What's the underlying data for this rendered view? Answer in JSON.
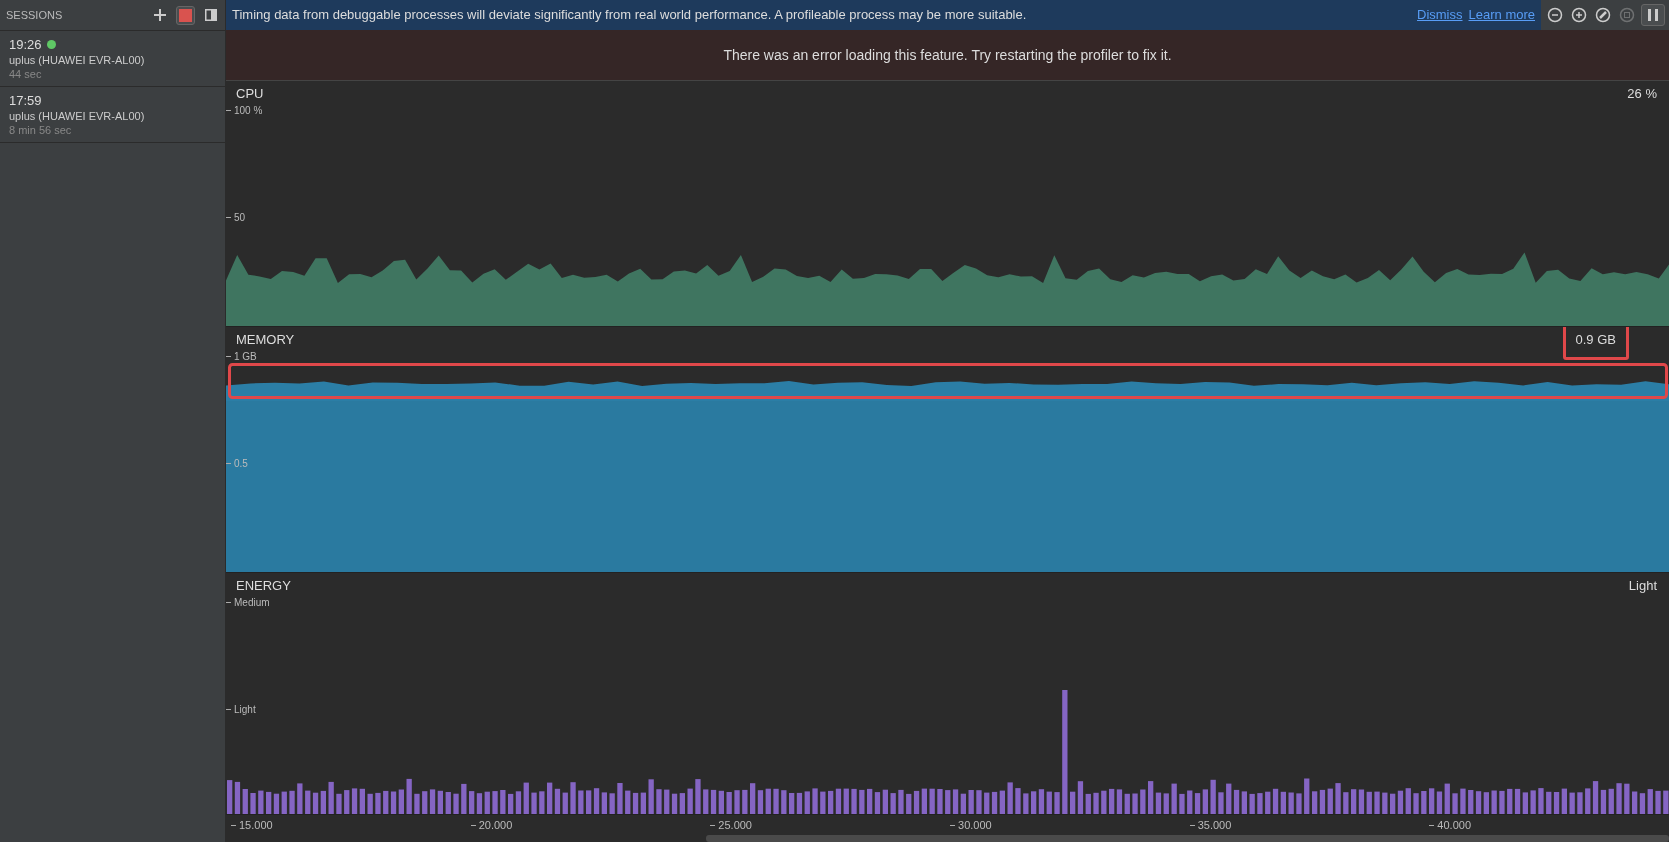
{
  "sessions": {
    "title": "SESSIONS",
    "items": [
      {
        "time": "19:26",
        "live": true,
        "device": "uplus (HUAWEI EVR-AL00)",
        "duration": "44 sec"
      },
      {
        "time": "17:59",
        "live": false,
        "device": "uplus (HUAWEI EVR-AL00)",
        "duration": "8 min 56 sec"
      }
    ]
  },
  "banner": {
    "message": "Timing data from debuggable processes will deviate significantly from real world performance. A profileable process may be more suitable.",
    "links": [
      "Dismiss",
      "Learn more"
    ]
  },
  "toolbar": [
    {
      "kind": "zoom-out",
      "disabled": false
    },
    {
      "kind": "zoom-in",
      "disabled": false
    },
    {
      "kind": "reset-zoom",
      "disabled": false
    },
    {
      "kind": "attach",
      "disabled": true
    },
    {
      "kind": "pause",
      "disabled": false
    }
  ],
  "error": "There was an error loading this feature. Try restarting the profiler to fix it.",
  "monitors": [
    {
      "kind": "cpu",
      "title": "CPU",
      "reading": "26 %",
      "ticks": [
        "100 %",
        "50"
      ],
      "highlighted": false
    },
    {
      "kind": "memory",
      "title": "MEMORY",
      "reading": "0.9 GB",
      "ticks": [
        "1 GB",
        "0.5"
      ],
      "highlighted": true
    },
    {
      "kind": "energy",
      "title": "ENERGY",
      "reading": "Light",
      "ticks": [
        "Medium",
        "Light"
      ],
      "highlighted": false
    }
  ],
  "time_axis": [
    "15.000",
    "20.000",
    "25.000",
    "30.000",
    "35.000",
    "40.000"
  ]
}
